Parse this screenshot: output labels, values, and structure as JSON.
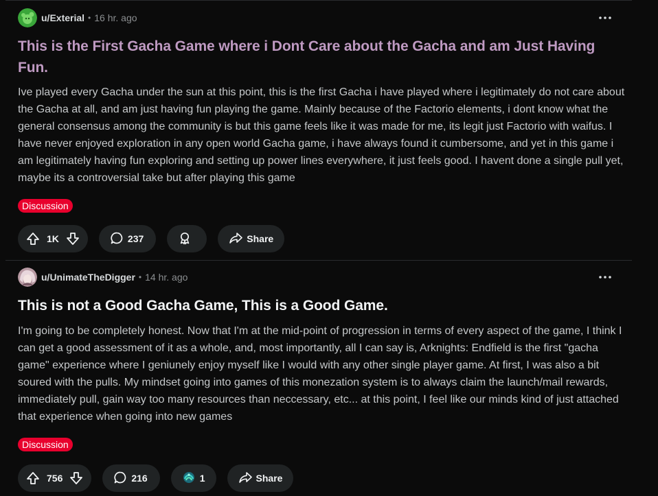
{
  "posts": [
    {
      "username": "u/Exterial",
      "separator": "•",
      "time": "16 hr. ago",
      "title": "This is the First Gacha Game where i Dont Care about the Gacha and am Just Having Fun.",
      "body": "Ive played every Gacha under the sun at this point, this is the first Gacha i have played where i legitimately do not care about the Gacha at all, and am just having fun playing the game. Mainly because of the Factorio elements, i dont know what the general consensus among the community is but this game feels like it was made for me, its legit just Factorio with waifus. I have never enjoyed exploration in any open world Gacha game, i have always found it cumbersome, and yet in this game i am legitimately having fun exploring and setting up power lines everywhere, it just feels good. I havent done a single pull yet, maybe its a controversial take but after playing this game",
      "flair": "Discussion",
      "votes": "1K",
      "comments": "237",
      "award_count": "",
      "share_label": "Share",
      "avatar_icon": "green-snoo-avatar-icon"
    },
    {
      "username": "u/UnimateTheDigger",
      "separator": "•",
      "time": "14 hr. ago",
      "title": "This is not a Good Gacha Game, This is a Good Game.",
      "body": "I'm going to be completely honest. Now that I'm at the mid-point of progression in terms of every aspect of the game, I think I can get a good assessment of it as a whole, and, most importantly, all I can say is, Arknights: Endfield is the first \"gacha game\" experience where I geniunely enjoy myself like I would with any other single player game. At first, I was also a bit soured with the pulls. My mindset going into games of this monezation system is to always claim the launch/mail rewards, immediately pull, gain way too many resources than neccessary, etc... at this point, I feel like our minds kind of just attached that experience when going into new games",
      "flair": "Discussion",
      "votes": "756",
      "comments": "216",
      "award_count": "1",
      "share_label": "Share",
      "avatar_icon": "anime-girl-avatar-icon"
    }
  ],
  "colors": {
    "background": "#0b0b0b",
    "visited_title": "#bf9ac2",
    "flair_bg": "#e8002d",
    "pill_bg": "#202324"
  }
}
